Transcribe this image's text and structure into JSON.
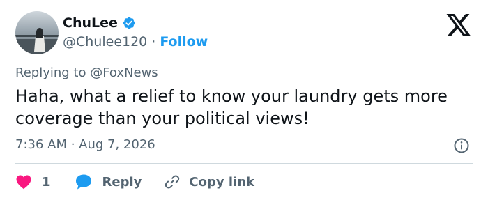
{
  "author": {
    "display_name": "ChuLee",
    "handle": "@Chulee120",
    "separator": "·",
    "follow_label": "Follow",
    "verified": true
  },
  "reply_to": "Replying to @FoxNews",
  "tweet_text": "Haha, what a relief to know your laundry gets more coverage than your political views!",
  "timestamp": "7:36 AM · Aug 7, 2026",
  "actions": {
    "like_count": "1",
    "reply_label": "Reply",
    "copy_link_label": "Copy link"
  },
  "icons": {
    "logo": "x-logo-icon",
    "verified": "verified-badge-icon",
    "info": "info-icon",
    "like": "heart-icon",
    "reply": "speech-bubble-icon",
    "copy": "link-icon"
  },
  "colors": {
    "accent": "#1d9bf0",
    "like": "#f91880",
    "text": "#0f1419",
    "muted": "#536471",
    "divider": "#cfd9de"
  }
}
